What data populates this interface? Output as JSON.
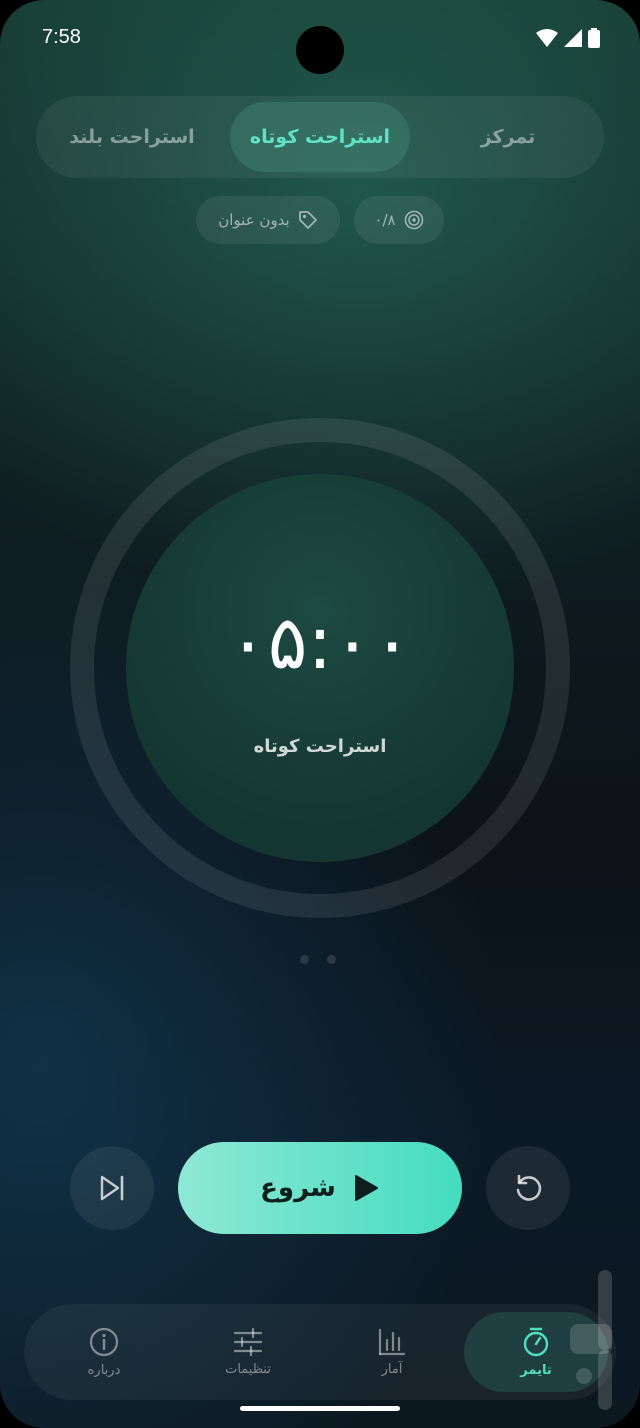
{
  "status_bar": {
    "time": "7:58"
  },
  "mode_tabs": [
    {
      "label": "تمرکز"
    },
    {
      "label": "استراحت کوتاه",
      "active": true
    },
    {
      "label": "استراحت بلند"
    }
  ],
  "chips": {
    "tag": {
      "label": "بدون عنوان",
      "icon": "tag-icon"
    },
    "goal": {
      "label": "۰/۸",
      "icon": "target-icon"
    }
  },
  "timer": {
    "display": "۰۵:۰۰",
    "mode_label": "استراحت کوتاه"
  },
  "controls": {
    "start_label": "شروع",
    "skip_icon": "skip-next-icon",
    "reset_icon": "reset-icon"
  },
  "bottom_nav": [
    {
      "label": "تایمر",
      "icon": "stopwatch-icon",
      "active": true
    },
    {
      "label": "آمار",
      "icon": "bar-chart-icon"
    },
    {
      "label": "تنظیمات",
      "icon": "sliders-icon"
    },
    {
      "label": "درباره",
      "icon": "info-icon"
    }
  ],
  "colors": {
    "accent": "#4fe0c0",
    "start_button_from": "#8ee8d4",
    "start_button_to": "#45dcc0"
  }
}
